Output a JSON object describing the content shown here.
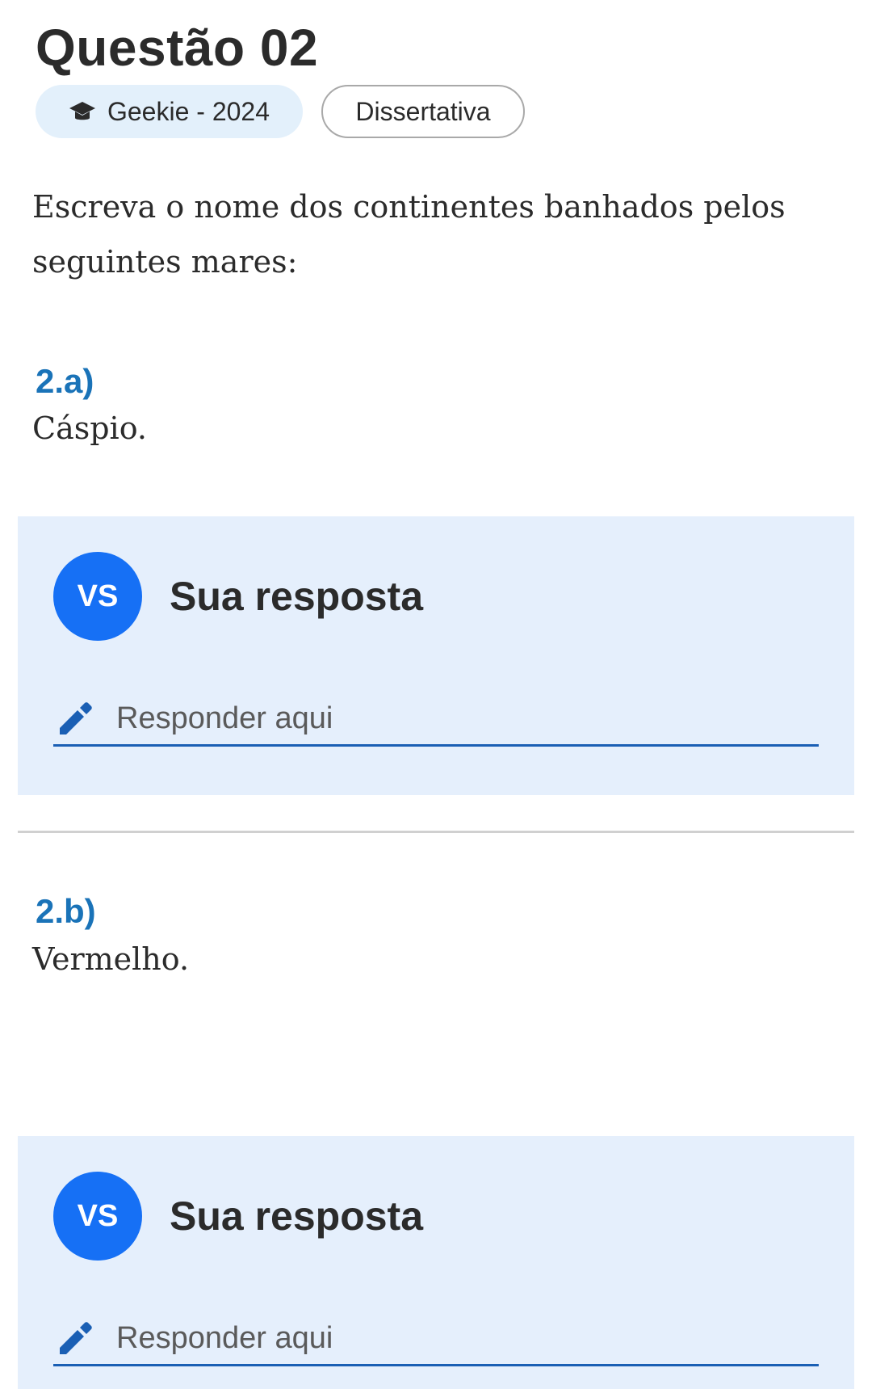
{
  "question": {
    "title": "Questão 02",
    "source_chip": {
      "label": "Geekie - 2024",
      "icon": "graduation-cap-icon"
    },
    "type_chip": {
      "label": "Dissertativa"
    },
    "prompt": "Escreva o nome dos continentes banhados pelos seguintes mares:"
  },
  "items": [
    {
      "label": "2.a)",
      "text": "Cáspio.",
      "answer": {
        "avatar_initials": "VS",
        "heading": "Sua resposta",
        "placeholder": "Responder aqui",
        "icon": "pencil-icon"
      }
    },
    {
      "label": "2.b)",
      "text": "Vermelho.",
      "answer": {
        "avatar_initials": "VS",
        "heading": "Sua resposta",
        "placeholder": "Responder aqui",
        "icon": "pencil-icon"
      }
    }
  ],
  "colors": {
    "accent_blue": "#1670f5",
    "label_blue": "#1a73b8",
    "card_background": "#e5effc",
    "chip_background": "#e3f0fb"
  }
}
